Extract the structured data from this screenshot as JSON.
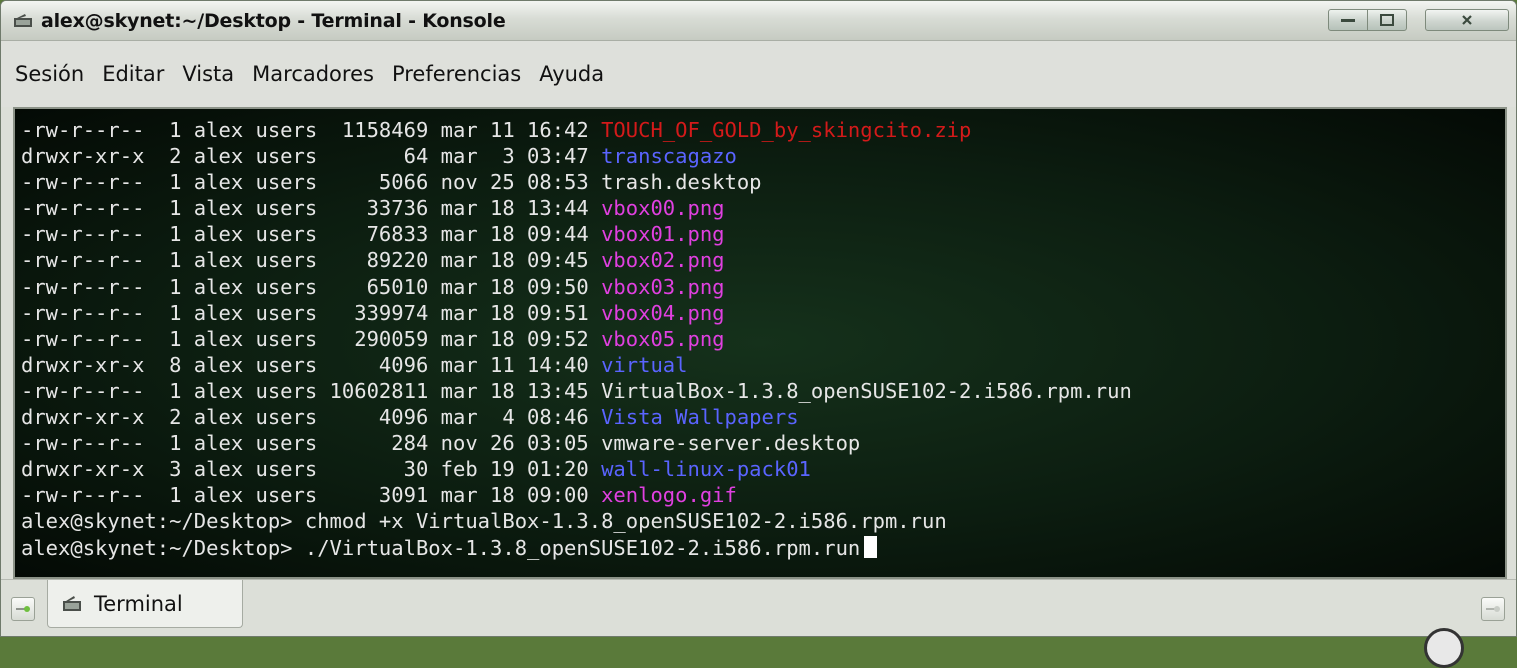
{
  "window": {
    "title": "alex@skynet:~/Desktop - Terminal - Konsole"
  },
  "menu": [
    "Sesión",
    "Editar",
    "Vista",
    "Marcadores",
    "Preferencias",
    "Ayuda"
  ],
  "terminal": {
    "listing": [
      {
        "perms": "-rw-r--r--",
        "links": "1",
        "owner": "alex",
        "group": "users",
        "size": "1158469",
        "month": "mar",
        "day": "11",
        "time": "16:42",
        "name": "TOUCH_OF_GOLD_by_skingcito.zip",
        "color": "red"
      },
      {
        "perms": "drwxr-xr-x",
        "links": "2",
        "owner": "alex",
        "group": "users",
        "size": "64",
        "month": "mar",
        "day": "3",
        "time": "03:47",
        "name": "transcagazo",
        "color": "blue"
      },
      {
        "perms": "-rw-r--r--",
        "links": "1",
        "owner": "alex",
        "group": "users",
        "size": "5066",
        "month": "nov",
        "day": "25",
        "time": "08:53",
        "name": "trash.desktop",
        "color": "white"
      },
      {
        "perms": "-rw-r--r--",
        "links": "1",
        "owner": "alex",
        "group": "users",
        "size": "33736",
        "month": "mar",
        "day": "18",
        "time": "13:44",
        "name": "vbox00.png",
        "color": "magenta"
      },
      {
        "perms": "-rw-r--r--",
        "links": "1",
        "owner": "alex",
        "group": "users",
        "size": "76833",
        "month": "mar",
        "day": "18",
        "time": "09:44",
        "name": "vbox01.png",
        "color": "magenta"
      },
      {
        "perms": "-rw-r--r--",
        "links": "1",
        "owner": "alex",
        "group": "users",
        "size": "89220",
        "month": "mar",
        "day": "18",
        "time": "09:45",
        "name": "vbox02.png",
        "color": "magenta"
      },
      {
        "perms": "-rw-r--r--",
        "links": "1",
        "owner": "alex",
        "group": "users",
        "size": "65010",
        "month": "mar",
        "day": "18",
        "time": "09:50",
        "name": "vbox03.png",
        "color": "magenta"
      },
      {
        "perms": "-rw-r--r--",
        "links": "1",
        "owner": "alex",
        "group": "users",
        "size": "339974",
        "month": "mar",
        "day": "18",
        "time": "09:51",
        "name": "vbox04.png",
        "color": "magenta"
      },
      {
        "perms": "-rw-r--r--",
        "links": "1",
        "owner": "alex",
        "group": "users",
        "size": "290059",
        "month": "mar",
        "day": "18",
        "time": "09:52",
        "name": "vbox05.png",
        "color": "magenta"
      },
      {
        "perms": "drwxr-xr-x",
        "links": "8",
        "owner": "alex",
        "group": "users",
        "size": "4096",
        "month": "mar",
        "day": "11",
        "time": "14:40",
        "name": "virtual",
        "color": "blue"
      },
      {
        "perms": "-rw-r--r--",
        "links": "1",
        "owner": "alex",
        "group": "users",
        "size": "10602811",
        "month": "mar",
        "day": "18",
        "time": "13:45",
        "name": "VirtualBox-1.3.8_openSUSE102-2.i586.rpm.run",
        "color": "white"
      },
      {
        "perms": "drwxr-xr-x",
        "links": "2",
        "owner": "alex",
        "group": "users",
        "size": "4096",
        "month": "mar",
        "day": "4",
        "time": "08:46",
        "name": "Vista Wallpapers",
        "color": "blue"
      },
      {
        "perms": "-rw-r--r--",
        "links": "1",
        "owner": "alex",
        "group": "users",
        "size": "284",
        "month": "nov",
        "day": "26",
        "time": "03:05",
        "name": "vmware-server.desktop",
        "color": "white"
      },
      {
        "perms": "drwxr-xr-x",
        "links": "3",
        "owner": "alex",
        "group": "users",
        "size": "30",
        "month": "feb",
        "day": "19",
        "time": "01:20",
        "name": "wall-linux-pack01",
        "color": "blue"
      },
      {
        "perms": "-rw-r--r--",
        "links": "1",
        "owner": "alex",
        "group": "users",
        "size": "3091",
        "month": "mar",
        "day": "18",
        "time": "09:00",
        "name": "xenlogo.gif",
        "color": "magenta"
      }
    ],
    "commands": [
      {
        "prompt": "alex@skynet:~/Desktop>",
        "command": "chmod +x VirtualBox-1.3.8_openSUSE102-2.i586.rpm.run"
      },
      {
        "prompt": "alex@skynet:~/Desktop>",
        "command": "./VirtualBox-1.3.8_openSUSE102-2.i586.rpm.run"
      }
    ]
  },
  "tabs": [
    {
      "label": "Terminal"
    }
  ],
  "colors": {
    "red": "#d41a1a",
    "blue": "#5a64ff",
    "magenta": "#e040e0",
    "white": "#e6e6e6",
    "background": "#0c1d10"
  },
  "icons": {
    "title": "konsole-icon",
    "new_tab": "new-tab-icon",
    "close_tab": "close-tab-icon",
    "tab": "terminal-icon"
  }
}
